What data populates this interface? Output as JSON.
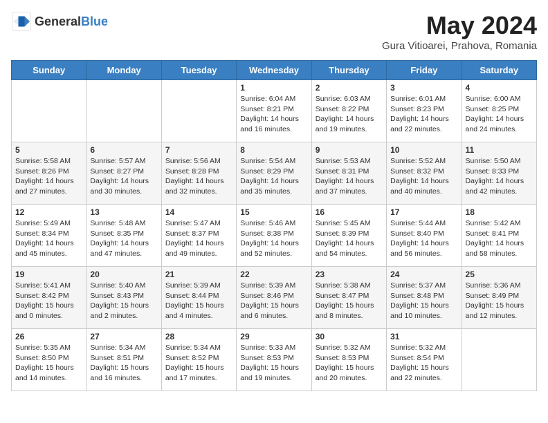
{
  "header": {
    "logo_general": "General",
    "logo_blue": "Blue",
    "title": "May 2024",
    "subtitle": "Gura Vitioarei, Prahova, Romania"
  },
  "calendar": {
    "days_of_week": [
      "Sunday",
      "Monday",
      "Tuesday",
      "Wednesday",
      "Thursday",
      "Friday",
      "Saturday"
    ],
    "weeks": [
      [
        {
          "day": "",
          "info": ""
        },
        {
          "day": "",
          "info": ""
        },
        {
          "day": "",
          "info": ""
        },
        {
          "day": "1",
          "info": "Sunrise: 6:04 AM\nSunset: 8:21 PM\nDaylight: 14 hours and 16 minutes."
        },
        {
          "day": "2",
          "info": "Sunrise: 6:03 AM\nSunset: 8:22 PM\nDaylight: 14 hours and 19 minutes."
        },
        {
          "day": "3",
          "info": "Sunrise: 6:01 AM\nSunset: 8:23 PM\nDaylight: 14 hours and 22 minutes."
        },
        {
          "day": "4",
          "info": "Sunrise: 6:00 AM\nSunset: 8:25 PM\nDaylight: 14 hours and 24 minutes."
        }
      ],
      [
        {
          "day": "5",
          "info": "Sunrise: 5:58 AM\nSunset: 8:26 PM\nDaylight: 14 hours and 27 minutes."
        },
        {
          "day": "6",
          "info": "Sunrise: 5:57 AM\nSunset: 8:27 PM\nDaylight: 14 hours and 30 minutes."
        },
        {
          "day": "7",
          "info": "Sunrise: 5:56 AM\nSunset: 8:28 PM\nDaylight: 14 hours and 32 minutes."
        },
        {
          "day": "8",
          "info": "Sunrise: 5:54 AM\nSunset: 8:29 PM\nDaylight: 14 hours and 35 minutes."
        },
        {
          "day": "9",
          "info": "Sunrise: 5:53 AM\nSunset: 8:31 PM\nDaylight: 14 hours and 37 minutes."
        },
        {
          "day": "10",
          "info": "Sunrise: 5:52 AM\nSunset: 8:32 PM\nDaylight: 14 hours and 40 minutes."
        },
        {
          "day": "11",
          "info": "Sunrise: 5:50 AM\nSunset: 8:33 PM\nDaylight: 14 hours and 42 minutes."
        }
      ],
      [
        {
          "day": "12",
          "info": "Sunrise: 5:49 AM\nSunset: 8:34 PM\nDaylight: 14 hours and 45 minutes."
        },
        {
          "day": "13",
          "info": "Sunrise: 5:48 AM\nSunset: 8:35 PM\nDaylight: 14 hours and 47 minutes."
        },
        {
          "day": "14",
          "info": "Sunrise: 5:47 AM\nSunset: 8:37 PM\nDaylight: 14 hours and 49 minutes."
        },
        {
          "day": "15",
          "info": "Sunrise: 5:46 AM\nSunset: 8:38 PM\nDaylight: 14 hours and 52 minutes."
        },
        {
          "day": "16",
          "info": "Sunrise: 5:45 AM\nSunset: 8:39 PM\nDaylight: 14 hours and 54 minutes."
        },
        {
          "day": "17",
          "info": "Sunrise: 5:44 AM\nSunset: 8:40 PM\nDaylight: 14 hours and 56 minutes."
        },
        {
          "day": "18",
          "info": "Sunrise: 5:42 AM\nSunset: 8:41 PM\nDaylight: 14 hours and 58 minutes."
        }
      ],
      [
        {
          "day": "19",
          "info": "Sunrise: 5:41 AM\nSunset: 8:42 PM\nDaylight: 15 hours and 0 minutes."
        },
        {
          "day": "20",
          "info": "Sunrise: 5:40 AM\nSunset: 8:43 PM\nDaylight: 15 hours and 2 minutes."
        },
        {
          "day": "21",
          "info": "Sunrise: 5:39 AM\nSunset: 8:44 PM\nDaylight: 15 hours and 4 minutes."
        },
        {
          "day": "22",
          "info": "Sunrise: 5:39 AM\nSunset: 8:46 PM\nDaylight: 15 hours and 6 minutes."
        },
        {
          "day": "23",
          "info": "Sunrise: 5:38 AM\nSunset: 8:47 PM\nDaylight: 15 hours and 8 minutes."
        },
        {
          "day": "24",
          "info": "Sunrise: 5:37 AM\nSunset: 8:48 PM\nDaylight: 15 hours and 10 minutes."
        },
        {
          "day": "25",
          "info": "Sunrise: 5:36 AM\nSunset: 8:49 PM\nDaylight: 15 hours and 12 minutes."
        }
      ],
      [
        {
          "day": "26",
          "info": "Sunrise: 5:35 AM\nSunset: 8:50 PM\nDaylight: 15 hours and 14 minutes."
        },
        {
          "day": "27",
          "info": "Sunrise: 5:34 AM\nSunset: 8:51 PM\nDaylight: 15 hours and 16 minutes."
        },
        {
          "day": "28",
          "info": "Sunrise: 5:34 AM\nSunset: 8:52 PM\nDaylight: 15 hours and 17 minutes."
        },
        {
          "day": "29",
          "info": "Sunrise: 5:33 AM\nSunset: 8:53 PM\nDaylight: 15 hours and 19 minutes."
        },
        {
          "day": "30",
          "info": "Sunrise: 5:32 AM\nSunset: 8:53 PM\nDaylight: 15 hours and 20 minutes."
        },
        {
          "day": "31",
          "info": "Sunrise: 5:32 AM\nSunset: 8:54 PM\nDaylight: 15 hours and 22 minutes."
        },
        {
          "day": "",
          "info": ""
        }
      ]
    ]
  }
}
